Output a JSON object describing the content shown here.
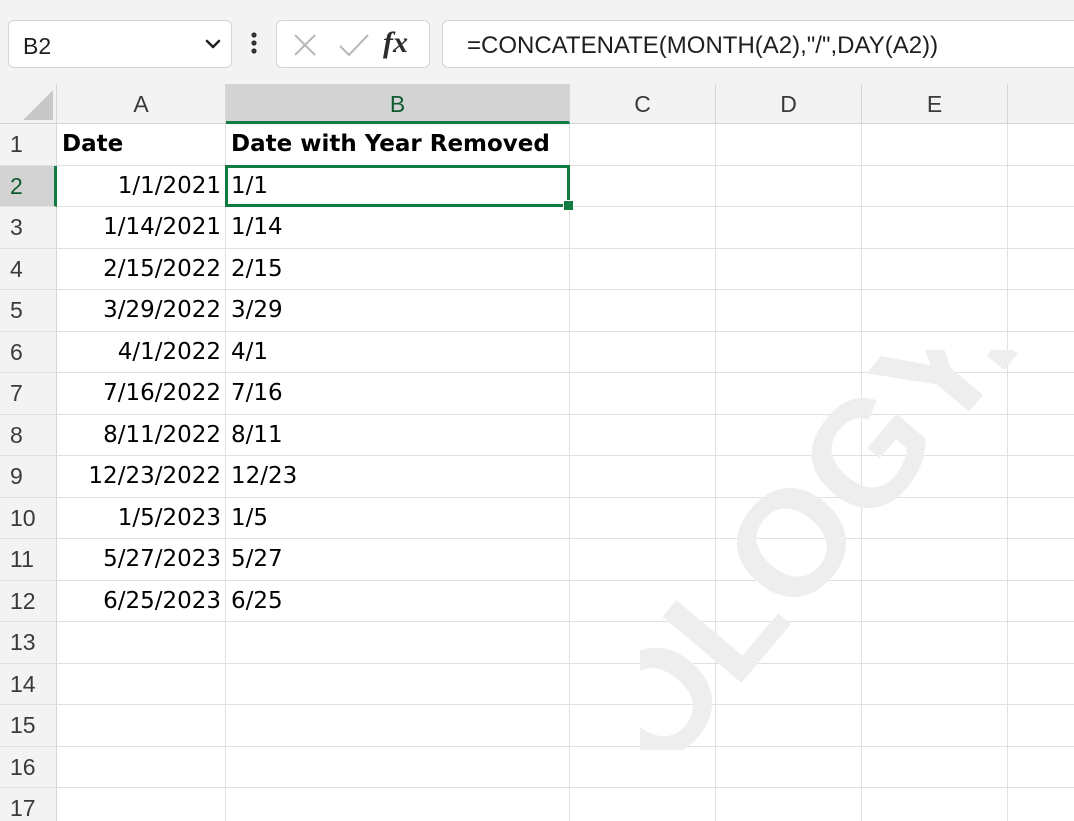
{
  "formula_bar": {
    "name_box": "B2",
    "fx_label": "fx",
    "formula": "=CONCATENATE(MONTH(A2),\"/\",DAY(A2))"
  },
  "grid": {
    "columns": [
      "A",
      "B",
      "C",
      "D",
      "E"
    ],
    "selected_column": "B",
    "selected_row": "2",
    "selected_cell": "B2",
    "rows": [
      {
        "row": "1",
        "a": "Date",
        "b": "Date with Year Removed"
      },
      {
        "row": "2",
        "a": "1/1/2021",
        "b": "1/1"
      },
      {
        "row": "3",
        "a": "1/14/2021",
        "b": "1/14"
      },
      {
        "row": "4",
        "a": "2/15/2022",
        "b": "2/15"
      },
      {
        "row": "5",
        "a": "3/29/2022",
        "b": "3/29"
      },
      {
        "row": "6",
        "a": "4/1/2022",
        "b": "4/1"
      },
      {
        "row": "7",
        "a": "7/16/2022",
        "b": "7/16"
      },
      {
        "row": "8",
        "a": "8/11/2022",
        "b": "8/11"
      },
      {
        "row": "9",
        "a": "12/23/2022",
        "b": "12/23"
      },
      {
        "row": "10",
        "a": "1/5/2023",
        "b": "1/5"
      },
      {
        "row": "11",
        "a": "5/27/2023",
        "b": "5/27"
      },
      {
        "row": "12",
        "a": "6/25/2023",
        "b": "6/25"
      },
      {
        "row": "13",
        "a": "",
        "b": ""
      },
      {
        "row": "14",
        "a": "",
        "b": ""
      },
      {
        "row": "15",
        "a": "",
        "b": ""
      },
      {
        "row": "16",
        "a": "",
        "b": ""
      },
      {
        "row": "17",
        "a": "",
        "b": ""
      }
    ]
  },
  "watermark": {
    "text": "OLOGY.CO",
    "color": "#eeeeee"
  },
  "colors": {
    "accent": "#107c41",
    "header_bg": "#f3f3f3",
    "selected_header_bg": "#d3d3d3"
  }
}
